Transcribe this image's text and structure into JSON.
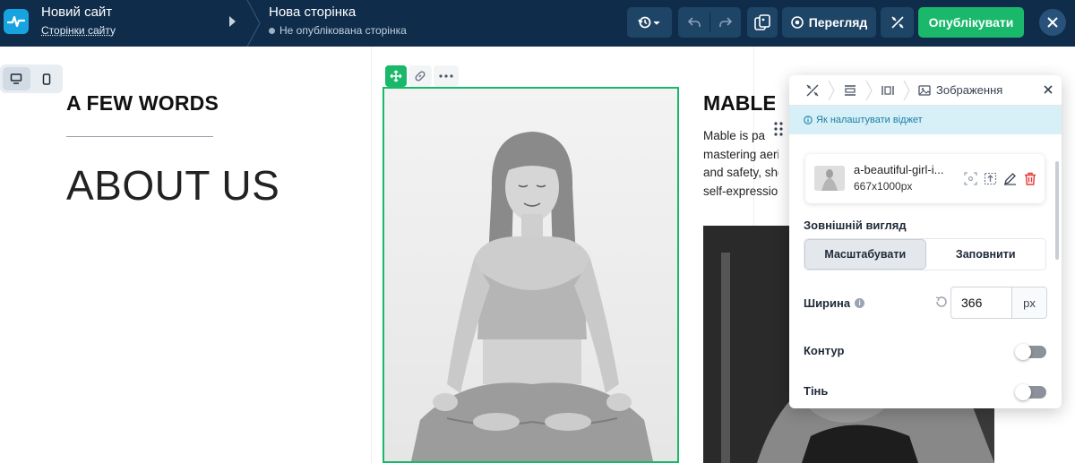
{
  "topbar": {
    "site_name": "Новий сайт",
    "site_pages": "Сторінки сайту",
    "page_name": "Нова сторінка",
    "page_status": "Не опублікована сторінка",
    "preview_label": "Перегляд",
    "publish_label": "Опублікувати",
    "colors": {
      "bar": "#0f2d4b",
      "publish": "#19b86b",
      "logo": "#16a3e0"
    }
  },
  "canvas": {
    "few_words": "A FEW WORDS",
    "about_us": "ABOUT US",
    "mable_title": "MABLE I",
    "mable_text": [
      "Mable is pa",
      "mastering aeria",
      "and safety, she",
      "self-expression"
    ]
  },
  "panel": {
    "breadcrumb_title": "Зображення",
    "help_link": "Як налаштувати віджет",
    "file_name": "a-beautiful-girl-i...",
    "file_size": "667x1000px",
    "appearance_title": "Зовнішній вигляд",
    "appearance_options": [
      "Масштабувати",
      "Заповнити"
    ],
    "appearance_selected": "Масштабувати",
    "width_label": "Ширина",
    "width_value": "366",
    "width_unit": "px",
    "contour_label": "Контур",
    "contour_on": false,
    "shadow_label": "Тінь",
    "shadow_on": false
  }
}
